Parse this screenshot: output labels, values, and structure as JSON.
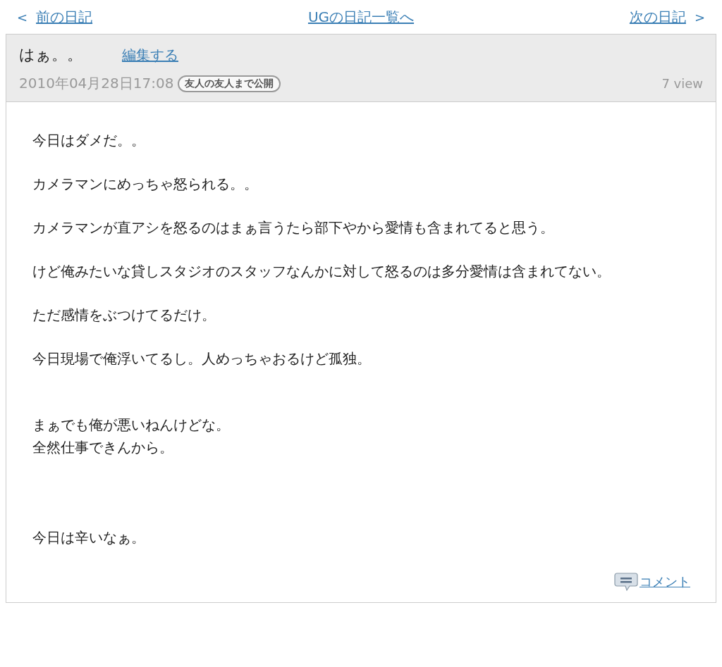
{
  "nav": {
    "prev": {
      "arrow": "<",
      "label": "前の日記"
    },
    "list": "UGの日記一覧へ",
    "next": {
      "label": "次の日記",
      "arrow": ">"
    }
  },
  "entry": {
    "title": "はぁ。。",
    "edit_link": "編集する",
    "date": "2010年04月28日17:08",
    "visibility": "友人の友人まで公開",
    "views": "7 view"
  },
  "body": [
    {
      "lines": [
        "今日はダメだ。。"
      ]
    },
    {
      "lines": [
        "カメラマンにめっちゃ怒られる。。"
      ]
    },
    {
      "lines": [
        "カメラマンが直アシを怒るのはまぁ言うたら部下やから愛情も含まれてると思う。"
      ]
    },
    {
      "lines": [
        "けど俺みたいな貸しスタジオのスタッフなんかに対して怒るのは多分愛情は含まれてない。"
      ]
    },
    {
      "lines": [
        "ただ感情をぶつけてるだけ。"
      ]
    },
    {
      "lines": [
        "今日現場で俺浮いてるし。人めっちゃおるけど孤独。"
      ]
    },
    {
      "lines": [
        "まぁでも俺が悪いねんけどな。",
        "全然仕事できんから。"
      ]
    },
    {
      "lines": [
        "今日は辛いなぁ。"
      ]
    }
  ],
  "comment_link": "コメント"
}
